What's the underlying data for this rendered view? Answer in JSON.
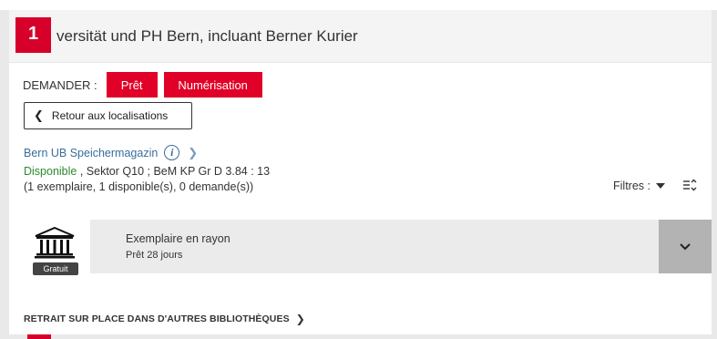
{
  "header": {
    "badge_number": "1",
    "title": "versität und PH Bern, incluant Berner Kurier"
  },
  "request": {
    "label": "DEMANDER :",
    "loan_button": "Prêt",
    "digitization_button": "Numérisation",
    "button_color": "#e10027"
  },
  "back_button": {
    "label": "Retour aux localisations",
    "icon": "chevron-left-icon"
  },
  "location": {
    "name": "Bern UB Speichermagazin",
    "info_icon": "info-icon",
    "chevron_icon": "chevron-right-icon"
  },
  "availability": {
    "status": "Disponible",
    "details": " , Sektor Q10 ; BeM KP Gr D 3.84 : 13",
    "counts": "(1 exemplaire, 1 disponible(s), 0 demande(s))",
    "status_color": "#2c8a2c"
  },
  "filters": {
    "label": "Filtres :",
    "sort_icon": "sort-icon"
  },
  "item": {
    "library_icon": "library-building-icon",
    "fee_badge": "Gratuit",
    "title": "Exemplaire en rayon",
    "loan_period": "Prêt 28 jours",
    "expand_icon": "chevron-down-icon"
  },
  "pickup": {
    "label": "RETRAIT SUR PLACE DANS D'AUTRES BIBLIOTHÈQUES"
  },
  "colors": {
    "accent": "#d6002a",
    "link": "#3a6d9a"
  }
}
